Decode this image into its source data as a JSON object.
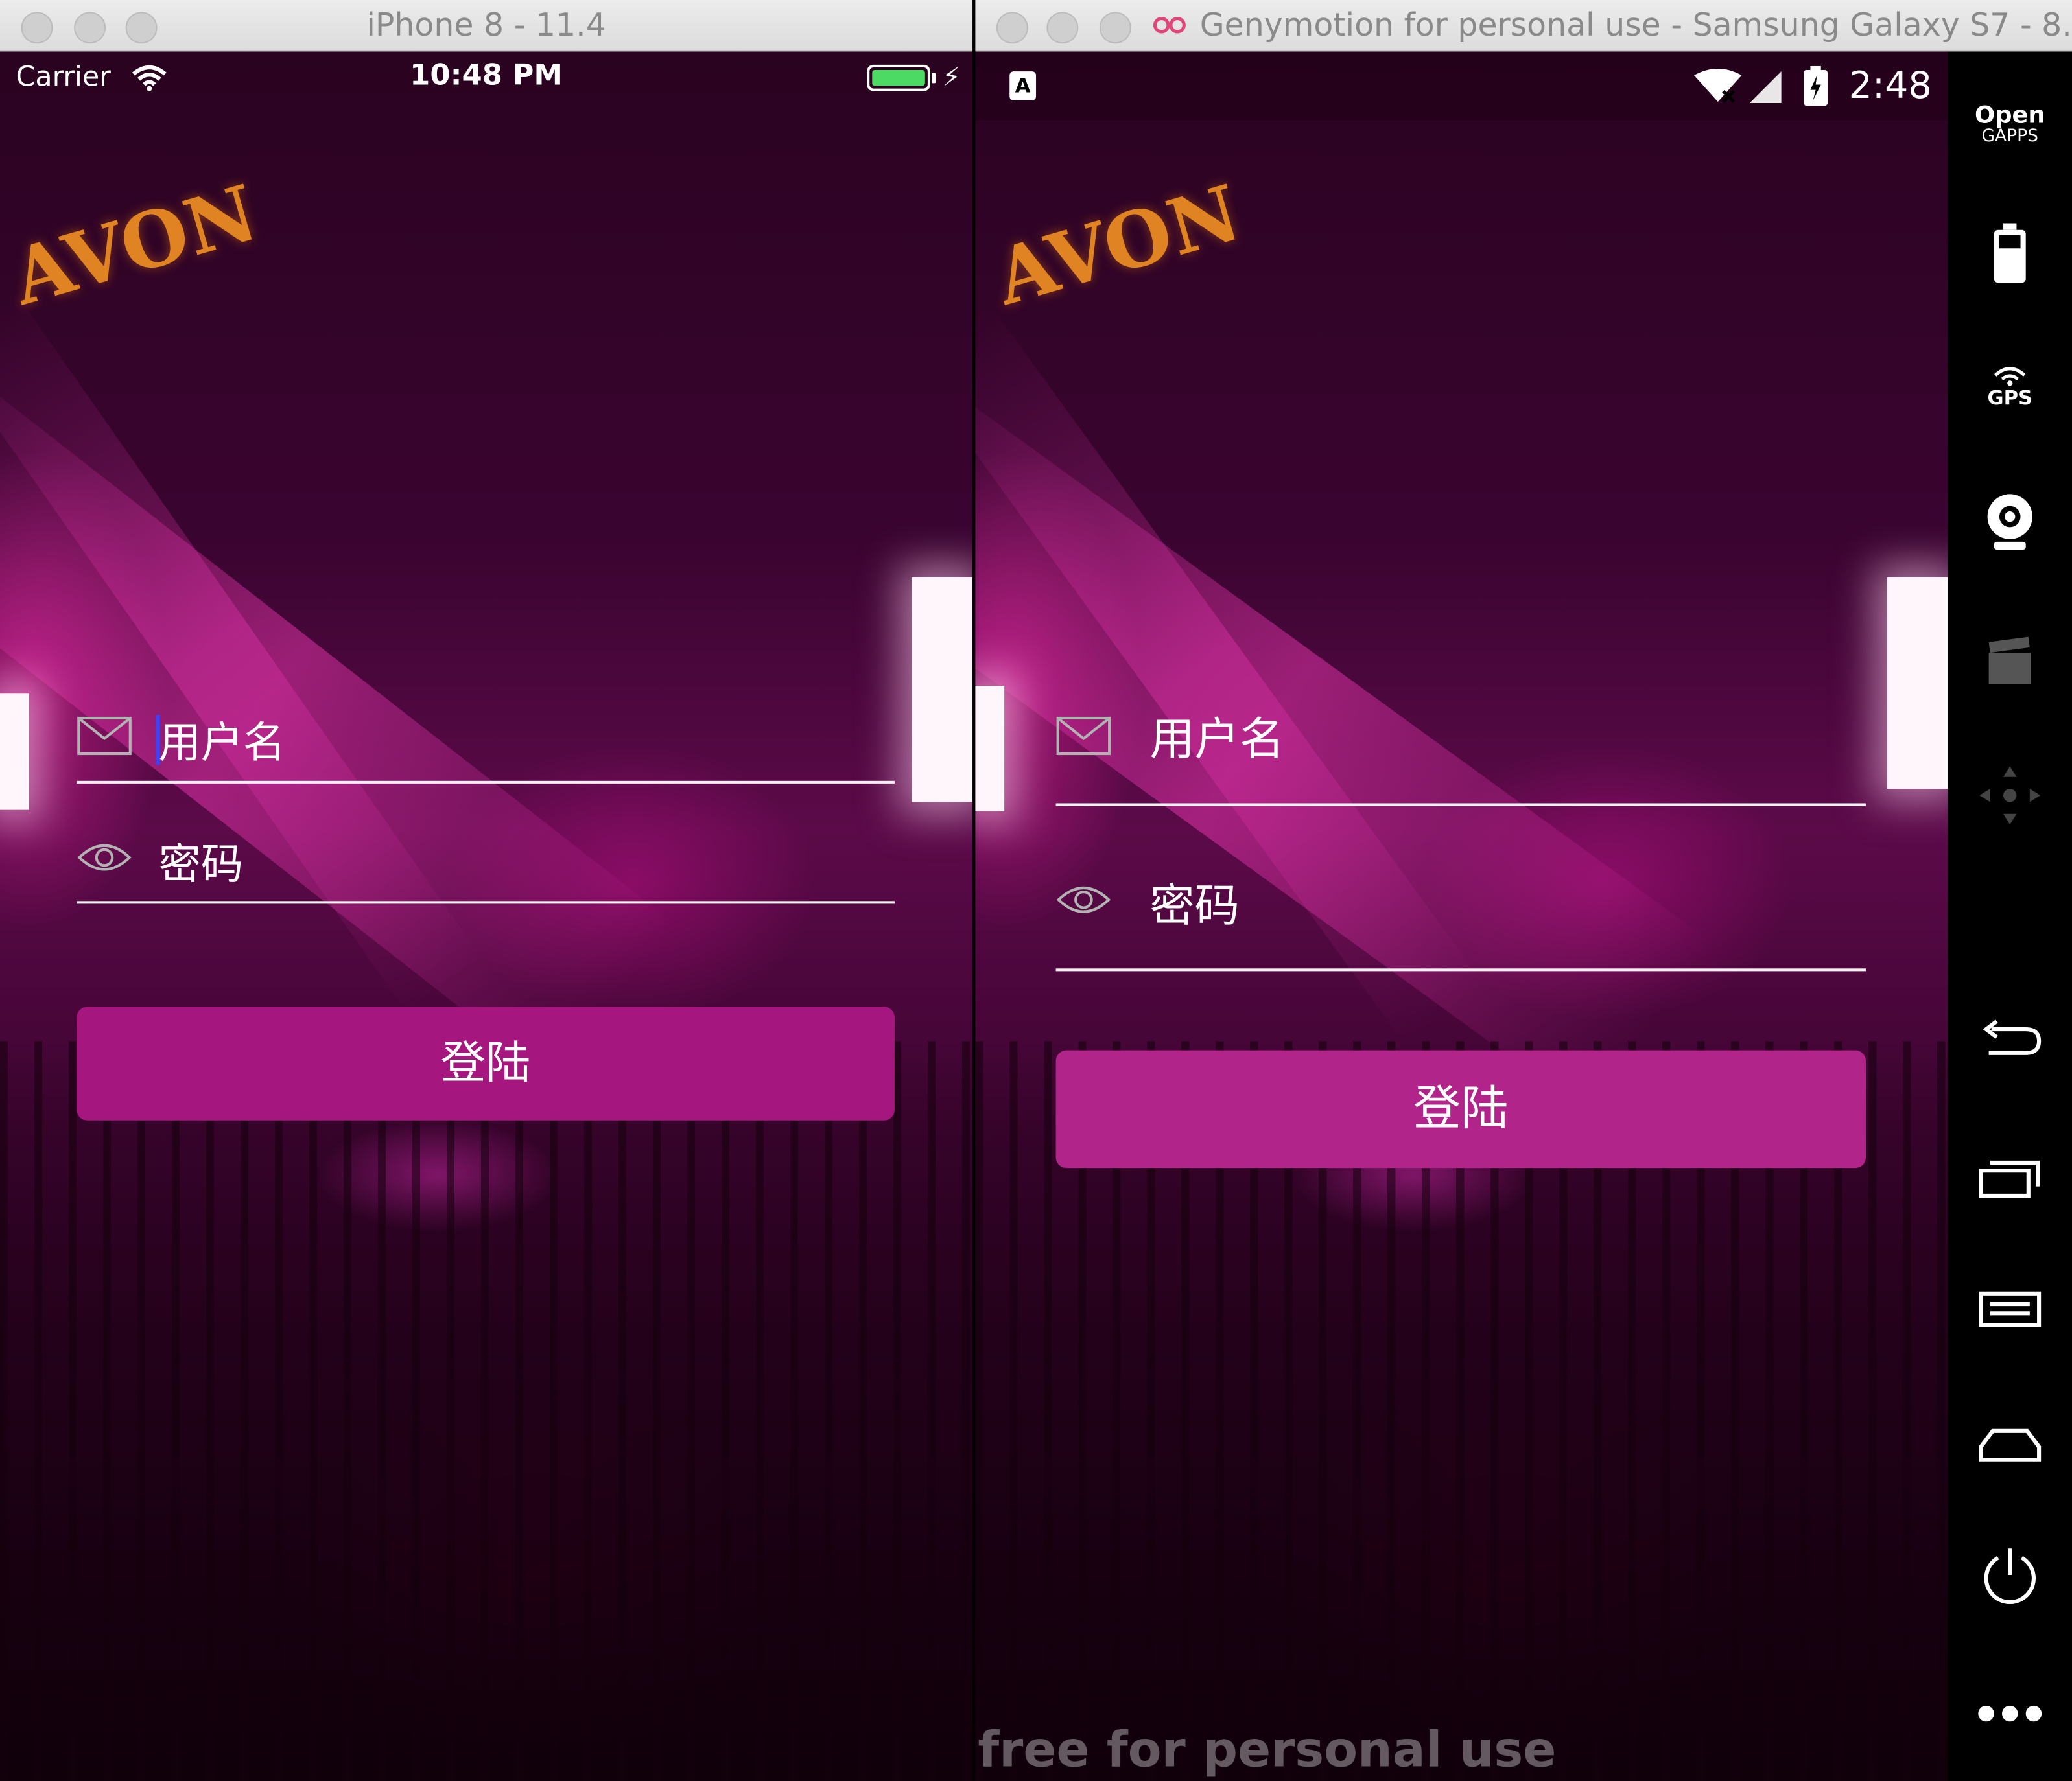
{
  "ios": {
    "window_title": "iPhone 8 - 11.4",
    "carrier": "Carrier",
    "time": "10:48 PM",
    "username_placeholder": "用户名",
    "password_placeholder": "密码",
    "login_label": "登陆"
  },
  "android": {
    "window_title": "Genymotion for personal use - Samsung Galaxy S7 - 8....",
    "time": "2:48",
    "username_placeholder": "用户名",
    "password_placeholder": "密码",
    "login_label": "登陆",
    "watermark": "free for personal use"
  },
  "sidebar": {
    "open_gapps_line1": "Open",
    "open_gapps_line2": "GAPPS",
    "gps_label": "GPS"
  },
  "background_sign": "AVON",
  "colors": {
    "button_ios": "#a5167e",
    "button_android": "#b1258b",
    "battery_green": "#4cd964"
  }
}
